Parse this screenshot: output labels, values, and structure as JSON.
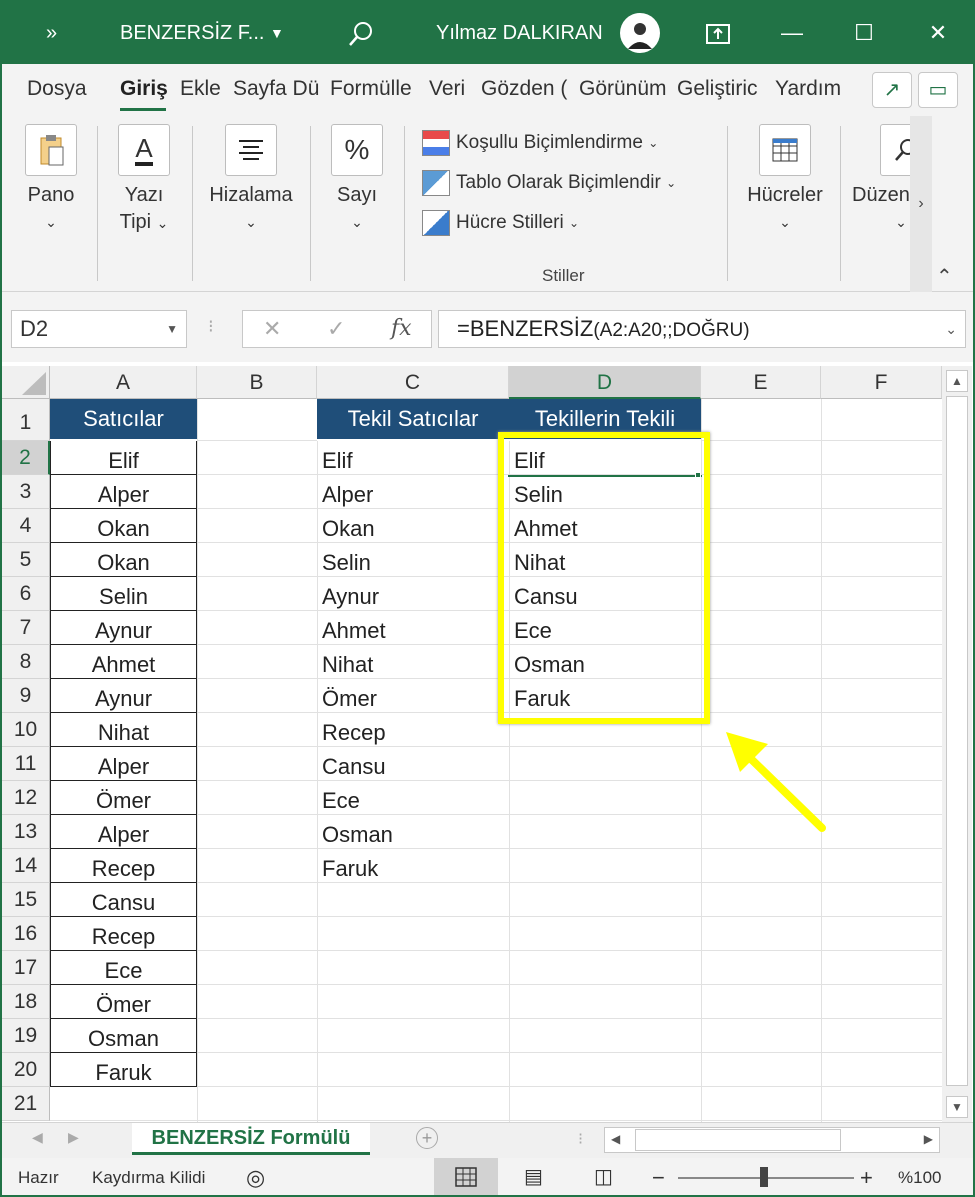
{
  "title": {
    "file_name": "BENZERSİZ F...",
    "user_name": "Yılmaz DALKIRAN",
    "overflow_icon": "»"
  },
  "ribbon_tabs": [
    "Dosya",
    "Giriş",
    "Ekle",
    "Sayfa Dü",
    "Formülle",
    "Veri",
    "Gözden (",
    "Görünüm",
    "Geliştiric",
    "Yardım"
  ],
  "ribbon": {
    "pano": "Pano",
    "yazi_tipi_1": "Yazı",
    "yazi_tipi_2": "Tipi",
    "hizalama": "Hizalama",
    "sayi": "Sayı",
    "kosullu": "Koşullu Biçimlendirme",
    "tablo": "Tablo Olarak Biçimlendir",
    "hucre_stilleri": "Hücre Stilleri",
    "stiller": "Stiller",
    "hucreler": "Hücreler",
    "duzen": "Düzen",
    "font_icon": "A",
    "percent_icon": "%"
  },
  "formula_bar": {
    "name_box": "D2",
    "formula_main": "=BENZERSİZ",
    "formula_args": "(A2:A20;;DOĞRU)",
    "fx": "fx"
  },
  "columns": [
    "A",
    "B",
    "C",
    "D",
    "E",
    "F"
  ],
  "rows": [
    "1",
    "2",
    "3",
    "4",
    "5",
    "6",
    "7",
    "8",
    "9",
    "10",
    "11",
    "12",
    "13",
    "14",
    "15",
    "16",
    "17",
    "18",
    "19",
    "20",
    "21"
  ],
  "headers": {
    "a1": "Satıcılar",
    "c1": "Tekil Satıcılar",
    "d1": "Tekillerin Tekili"
  },
  "column_a": [
    "Elif",
    "Alper",
    "Okan",
    "Okan",
    "Selin",
    "Aynur",
    "Ahmet",
    "Aynur",
    "Nihat",
    "Alper",
    "Ömer",
    "Alper",
    "Recep",
    "Cansu",
    "Recep",
    "Ece",
    "Ömer",
    "Osman",
    "Faruk"
  ],
  "column_c": [
    "Elif",
    "Alper",
    "Okan",
    "Selin",
    "Aynur",
    "Ahmet",
    "Nihat",
    "Ömer",
    "Recep",
    "Cansu",
    "Ece",
    "Osman",
    "Faruk"
  ],
  "column_d": [
    "Elif",
    "Selin",
    "Ahmet",
    "Nihat",
    "Cansu",
    "Ece",
    "Osman",
    "Faruk"
  ],
  "sheet_tab": "BENZERSİZ Formülü",
  "status": {
    "mode": "Hazır",
    "scroll_lock": "Kaydırma Kilidi",
    "zoom": "%100"
  },
  "colors": {
    "excel_green": "#217346",
    "header_fill": "#1f4e79",
    "highlight": "#ffff00"
  }
}
